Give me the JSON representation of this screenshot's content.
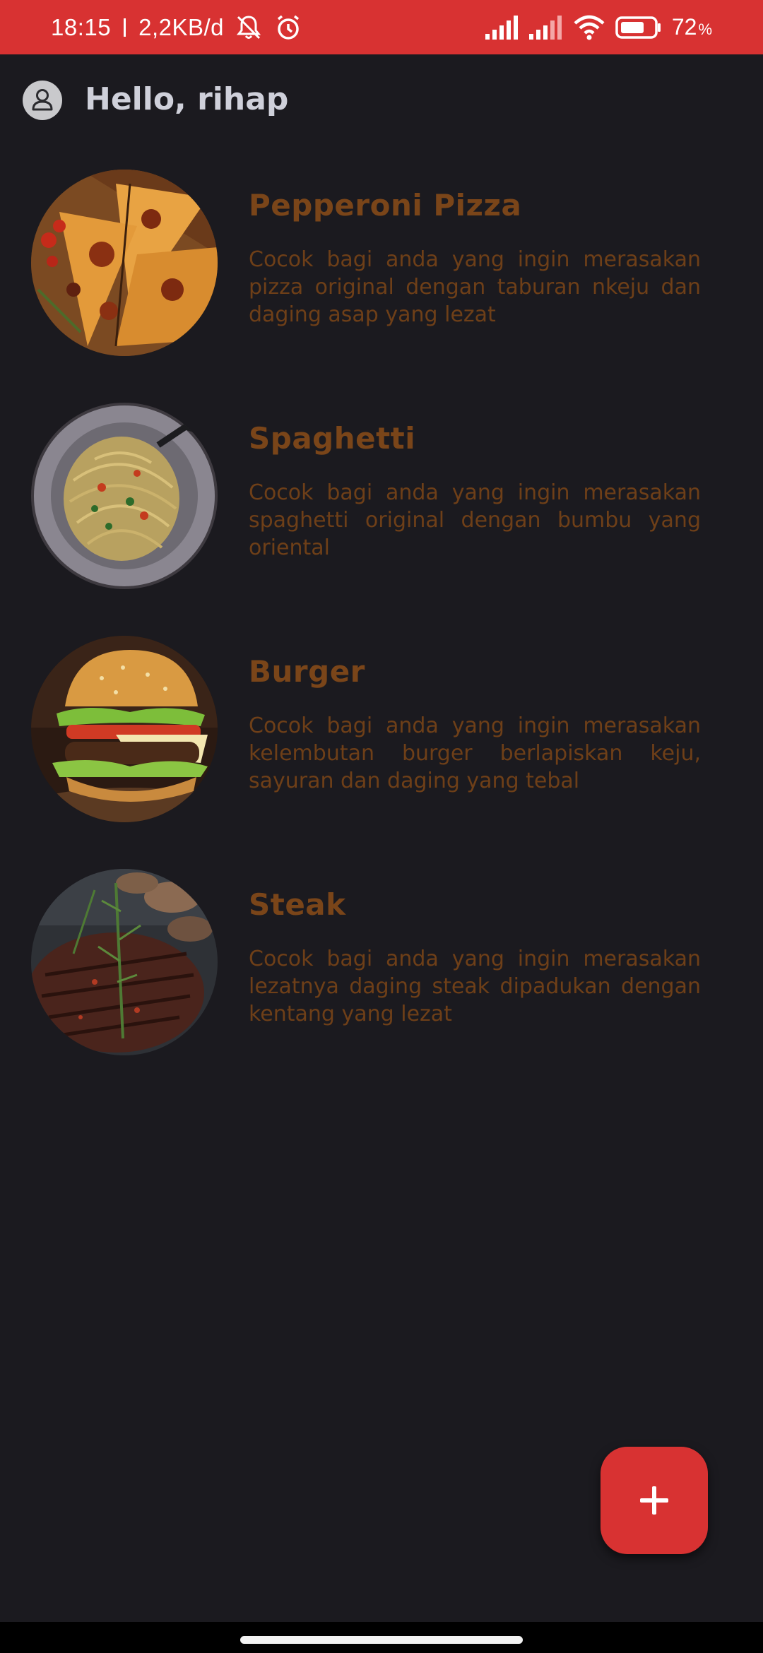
{
  "status_bar": {
    "time": "18:15",
    "network_speed": "2,2KB/d",
    "battery_percent": "72",
    "battery_level": 0.72,
    "icons": [
      "mute-icon",
      "alarm-icon",
      "signal-icon",
      "signal-icon-2",
      "wifi-icon",
      "battery-icon"
    ]
  },
  "header": {
    "greeting": "Hello, rihap",
    "avatar_icon": "user-icon"
  },
  "foods": [
    {
      "title": "Pepperoni Pizza",
      "description": "Cocok bagi anda yang ingin merasakan pizza original dengan taburan nkeju dan daging asap yang lezat"
    },
    {
      "title": "Spaghetti",
      "description": "Cocok bagi anda yang ingin merasakan spaghetti original dengan bumbu yang oriental"
    },
    {
      "title": "Burger",
      "description": "Cocok bagi anda yang ingin merasakan kelembutan burger berlapiskan keju, sayuran dan daging yang tebal"
    },
    {
      "title": "Steak",
      "description": "Cocok bagi anda yang ingin merasakan lezatnya daging steak dipadukan dengan kentang yang lezat"
    }
  ],
  "fab": {
    "icon": "plus-icon"
  },
  "colors": {
    "primary": "#d83232",
    "background": "#1b1a1f",
    "title": "#7a4519",
    "description": "#6e3f18",
    "greeting": "#cfd0da"
  }
}
